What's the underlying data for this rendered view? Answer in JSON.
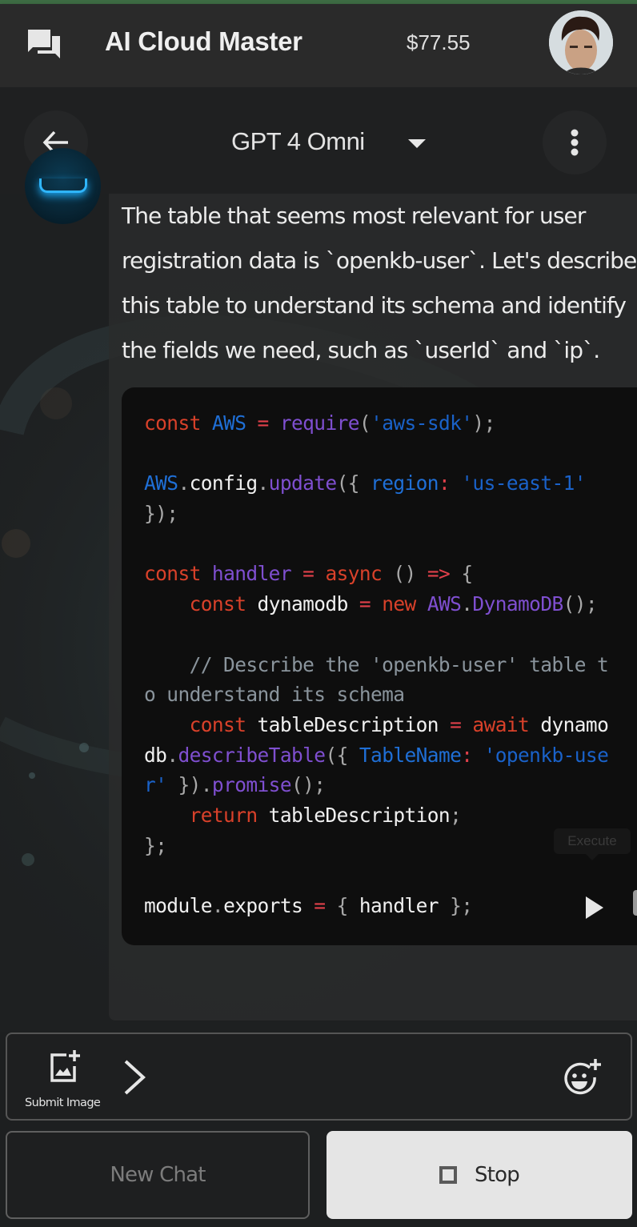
{
  "colors": {
    "accent_strip": "#3d6b43",
    "appbar_bg": "#2a2a2a",
    "page_bg": "#1e2021",
    "code_bg": "#0e0e0e",
    "keyword": "#d9412a",
    "function": "#7f4fd0",
    "identifier": "#1f6fd6",
    "string": "#1a62c9",
    "comment": "#8a949c"
  },
  "appbar": {
    "chat_icon": "chat-bubbles-icon",
    "title": "AI Cloud Master",
    "balance": "$77.55",
    "avatar": "user-avatar"
  },
  "subbar": {
    "back_icon": "arrow-left-icon",
    "model": "GPT 4 Omni",
    "model_caret_icon": "caret-down-icon",
    "menu_icon": "more-vertical-icon"
  },
  "message": {
    "lines": [
      "The table that seems most relevant for user",
      "registration data is `openkb-user`. Let's describe",
      "this table to understand its schema and identify",
      "the fields we need, such as `userId` and `ip`."
    ],
    "code": {
      "language": "javascript",
      "lines": [
        [
          [
            "kw",
            "const"
          ],
          [
            "pl",
            " "
          ],
          [
            "id",
            "AWS"
          ],
          [
            "pl",
            " "
          ],
          [
            "op",
            "="
          ],
          [
            "pl",
            " "
          ],
          [
            "fn",
            "require"
          ],
          [
            "pun",
            "("
          ],
          [
            "str",
            "'aws-sdk'"
          ],
          [
            "pun",
            ");"
          ]
        ],
        [],
        [
          [
            "id",
            "AWS"
          ],
          [
            "pun",
            "."
          ],
          [
            "pl",
            "config"
          ],
          [
            "pun",
            "."
          ],
          [
            "fn",
            "update"
          ],
          [
            "pun",
            "({"
          ],
          [
            "pl",
            " "
          ],
          [
            "id",
            "region"
          ],
          [
            "op",
            ":"
          ],
          [
            "pl",
            " "
          ],
          [
            "str",
            "'us-east-1'"
          ]
        ],
        [
          [
            "pun",
            "});"
          ]
        ],
        [],
        [
          [
            "kw",
            "const"
          ],
          [
            "pl",
            " "
          ],
          [
            "fn",
            "handler"
          ],
          [
            "pl",
            " "
          ],
          [
            "op",
            "="
          ],
          [
            "pl",
            " "
          ],
          [
            "kw",
            "async"
          ],
          [
            "pl",
            " "
          ],
          [
            "pun",
            "()"
          ],
          [
            "pl",
            " "
          ],
          [
            "op",
            "=>"
          ],
          [
            "pl",
            " "
          ],
          [
            "pun",
            "{"
          ]
        ],
        [
          [
            "pl",
            "    "
          ],
          [
            "kw",
            "const"
          ],
          [
            "pl",
            " dynamodb "
          ],
          [
            "op",
            "="
          ],
          [
            "pl",
            " "
          ],
          [
            "kw",
            "new"
          ],
          [
            "pl",
            " "
          ],
          [
            "fn",
            "AWS"
          ],
          [
            "pun",
            "."
          ],
          [
            "fn",
            "DynamoDB"
          ],
          [
            "pun",
            "();"
          ]
        ],
        [],
        [
          [
            "cm",
            "    // Describe the 'openkb-user' table t"
          ]
        ],
        [
          [
            "cm",
            "o understand its schema"
          ]
        ],
        [
          [
            "pl",
            "    "
          ],
          [
            "kw",
            "const"
          ],
          [
            "pl",
            " tableDescription "
          ],
          [
            "op",
            "="
          ],
          [
            "pl",
            " "
          ],
          [
            "kw",
            "await"
          ],
          [
            "pl",
            " dynamo"
          ]
        ],
        [
          [
            "pl",
            "db"
          ],
          [
            "pun",
            "."
          ],
          [
            "fn",
            "describeTable"
          ],
          [
            "pun",
            "({"
          ],
          [
            "pl",
            " "
          ],
          [
            "id",
            "TableName"
          ],
          [
            "op",
            ":"
          ],
          [
            "pl",
            " "
          ],
          [
            "str",
            "'openkb-use"
          ]
        ],
        [
          [
            "str",
            "r'"
          ],
          [
            "pl",
            " "
          ],
          [
            "pun",
            "})."
          ],
          [
            "fn",
            "promise"
          ],
          [
            "pun",
            "();"
          ]
        ],
        [
          [
            "pl",
            "    "
          ],
          [
            "kw",
            "return"
          ],
          [
            "pl",
            " tableDescription"
          ],
          [
            "pun",
            ";"
          ]
        ],
        [
          [
            "pun",
            "};"
          ]
        ],
        [],
        [
          [
            "pl",
            "module"
          ],
          [
            "pun",
            "."
          ],
          [
            "pl",
            "exports "
          ],
          [
            "op",
            "="
          ],
          [
            "pl",
            " "
          ],
          [
            "pun",
            "{"
          ],
          [
            "pl",
            " handler "
          ],
          [
            "pun",
            "};"
          ]
        ]
      ]
    },
    "tooltip": "Execute",
    "run_icon": "play-icon",
    "copy_icon": "copy-icon"
  },
  "composer": {
    "submit_image_label": "Submit Image",
    "submit_image_icon": "add-photo-icon",
    "expand_icon": "chevron-right-icon",
    "emoji_icon": "add-emoji-icon"
  },
  "actions": {
    "new_chat": "New Chat",
    "stop": "Stop",
    "stop_icon": "stop-square-icon"
  }
}
